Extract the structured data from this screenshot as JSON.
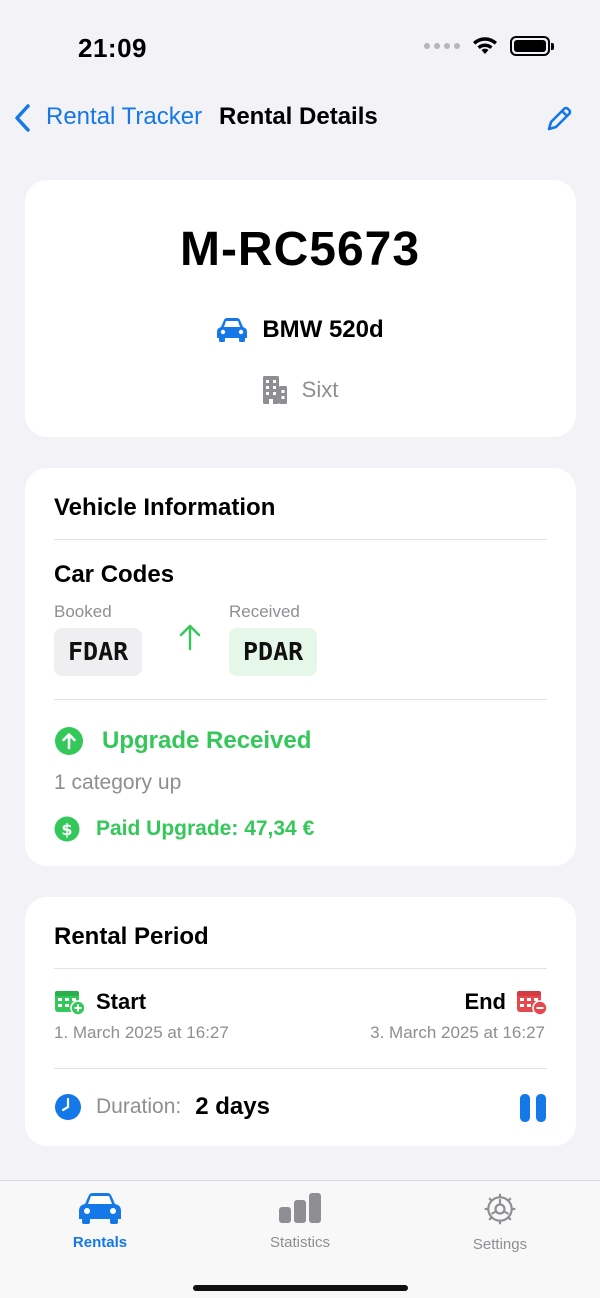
{
  "status_bar": {
    "time": "21:09"
  },
  "nav": {
    "back_label": "Rental Tracker",
    "title": "Rental Details"
  },
  "summary": {
    "plate": "M-RC5673",
    "car_model": "BMW 520d",
    "company": "Sixt"
  },
  "vehicle_info": {
    "title": "Vehicle Information",
    "codes_title": "Car Codes",
    "booked_label": "Booked",
    "booked_code": "FDAR",
    "received_label": "Received",
    "received_code": "PDAR",
    "upgrade_title": "Upgrade Received",
    "upgrade_detail": "1 category up",
    "paid_upgrade": "Paid Upgrade: 47,34 €"
  },
  "rental_period": {
    "title": "Rental Period",
    "start_label": "Start",
    "start_date": "1. March 2025 at 16:27",
    "end_label": "End",
    "end_date": "3. March 2025 at 16:27",
    "duration_label": "Duration:",
    "duration_value": "2 days"
  },
  "tabs": [
    {
      "label": "Rentals",
      "icon": "car-icon",
      "active": true
    },
    {
      "label": "Statistics",
      "icon": "chart-icon",
      "active": false
    },
    {
      "label": "Settings",
      "icon": "gear-icon",
      "active": false
    }
  ],
  "colors": {
    "accent": "#1478E8",
    "success": "#34C759",
    "danger": "#E5484D",
    "secondary_text": "#8E8E93"
  }
}
